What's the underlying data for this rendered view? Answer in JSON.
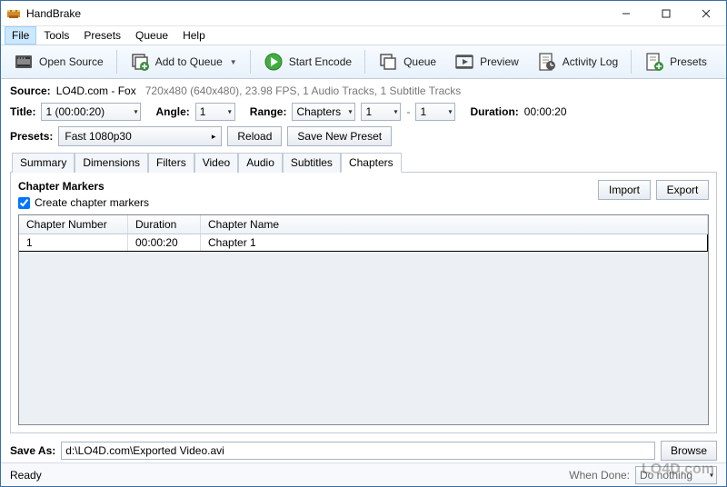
{
  "app": {
    "title": "HandBrake"
  },
  "menu": {
    "items": [
      "File",
      "Tools",
      "Presets",
      "Queue",
      "Help"
    ],
    "active_index": 0
  },
  "toolbar": {
    "open_source": "Open Source",
    "add_to_queue": "Add to Queue",
    "start_encode": "Start Encode",
    "queue": "Queue",
    "preview": "Preview",
    "activity_log": "Activity Log",
    "presets": "Presets"
  },
  "source": {
    "label": "Source:",
    "name": "LO4D.com - Fox",
    "meta": "720x480 (640x480), 23.98 FPS, 1 Audio Tracks, 1 Subtitle Tracks"
  },
  "title_row": {
    "title_label": "Title:",
    "title_value": "1 (00:00:20)",
    "angle_label": "Angle:",
    "angle_value": "1",
    "range_label": "Range:",
    "range_type": "Chapters",
    "range_from": "1",
    "range_dash": "-",
    "range_to": "1",
    "duration_label": "Duration:",
    "duration_value": "00:00:20"
  },
  "presets_row": {
    "label": "Presets:",
    "current": "Fast 1080p30",
    "reload": "Reload",
    "save_new": "Save New Preset"
  },
  "tabs": {
    "items": [
      "Summary",
      "Dimensions",
      "Filters",
      "Video",
      "Audio",
      "Subtitles",
      "Chapters"
    ],
    "active_index": 6
  },
  "chapters": {
    "section_title": "Chapter Markers",
    "create_label": "Create chapter markers",
    "create_checked": true,
    "import": "Import",
    "export": "Export",
    "columns": [
      "Chapter Number",
      "Duration",
      "Chapter Name"
    ],
    "rows": [
      {
        "number": "1",
        "duration": "00:00:20",
        "name": "Chapter 1"
      }
    ]
  },
  "save": {
    "label": "Save As:",
    "path": "d:\\LO4D.com\\Exported Video.avi",
    "browse": "Browse"
  },
  "status": {
    "ready": "Ready",
    "when_done_label": "When Done:",
    "when_done_value": "Do nothing"
  },
  "watermark": "LO4D.com"
}
